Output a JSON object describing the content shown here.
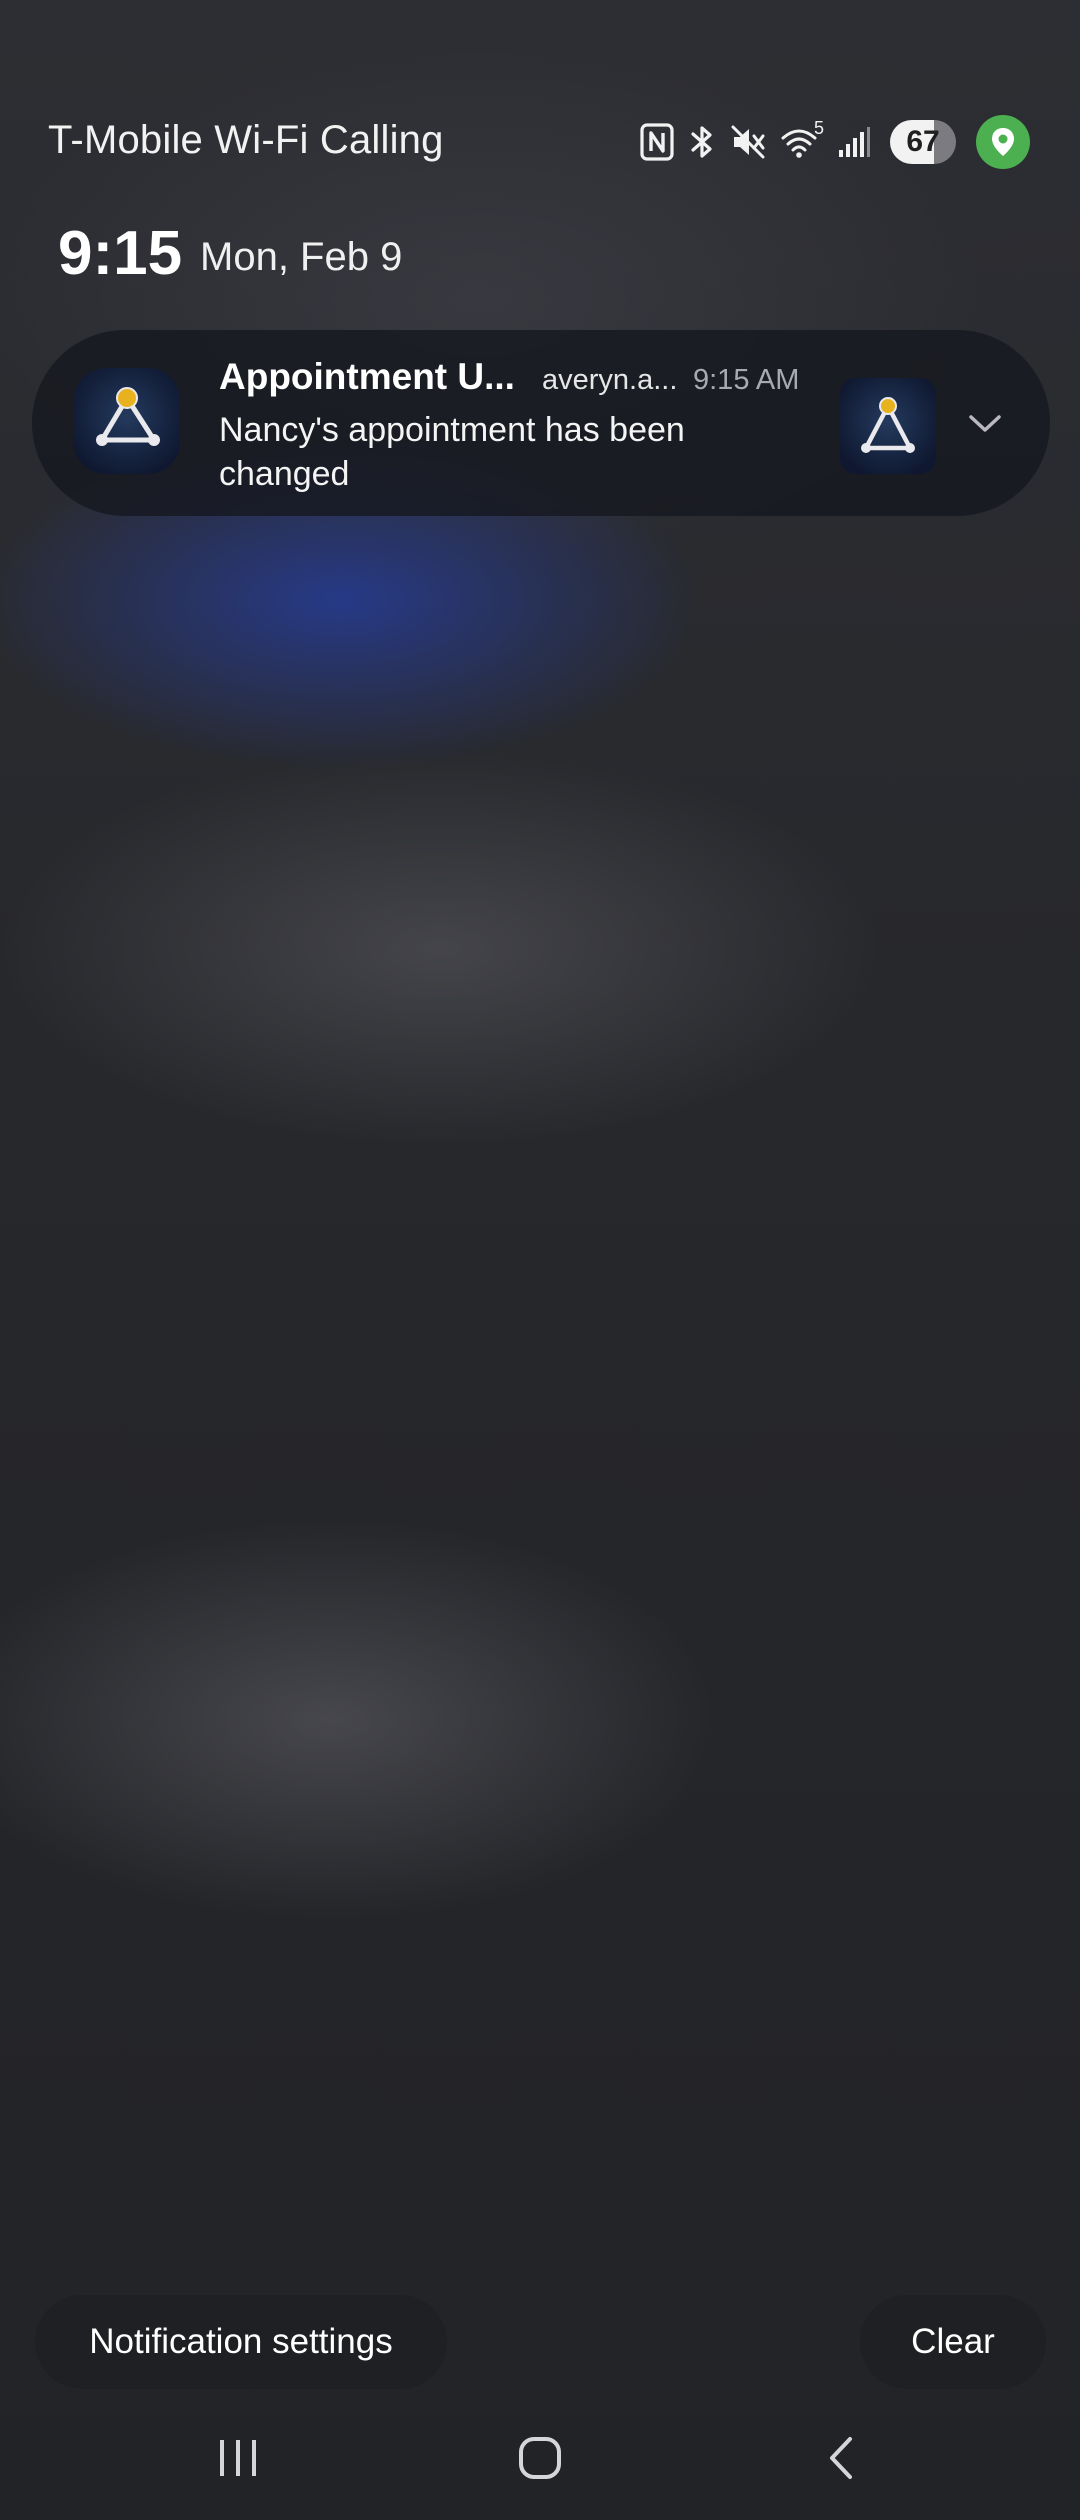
{
  "status_bar": {
    "carrier": "T-Mobile Wi-Fi Calling",
    "wifi_badge": "5",
    "battery_level": "67",
    "icons": [
      "nfc-icon",
      "bluetooth-icon",
      "mute-icon",
      "wifi-icon",
      "signal-icon",
      "battery-icon",
      "location-icon"
    ],
    "location_color": "#4caf50"
  },
  "clock": {
    "time": "9:15",
    "date": "Mon, Feb 9"
  },
  "notification": {
    "title": "Appointment U...",
    "account": "averyn.a...",
    "time": "9:15 AM",
    "body": "Nancy's appointment has been changed",
    "app_icon": "triangle-app-icon",
    "accent_color": "#e8b21e"
  },
  "actions": {
    "settings_label": "Notification settings",
    "clear_label": "Clear"
  },
  "navigation": {
    "buttons": [
      "recents-icon",
      "home-icon",
      "back-icon"
    ]
  }
}
